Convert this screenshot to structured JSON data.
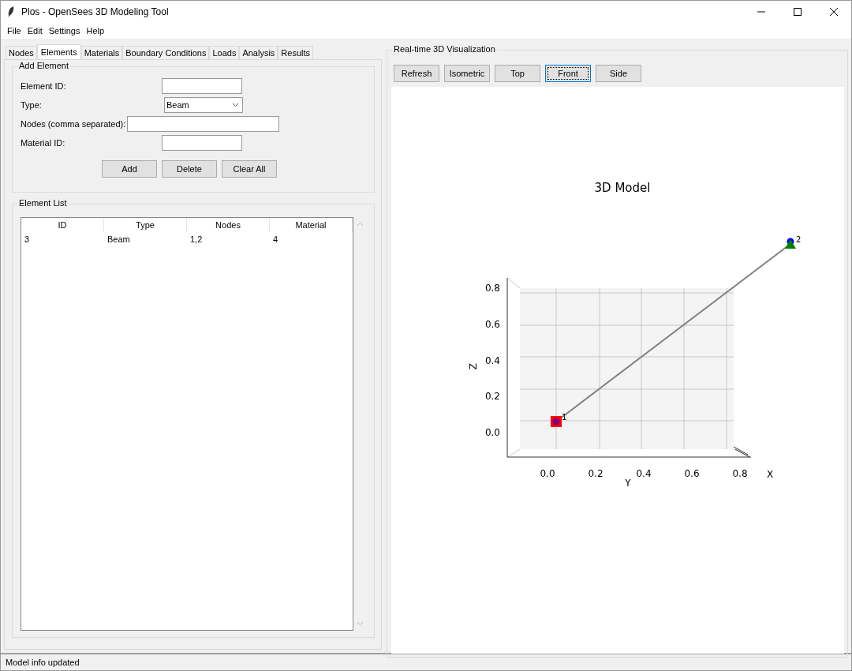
{
  "window": {
    "title": "Plos - OpenSees 3D Modeling Tool"
  },
  "menu": [
    "File",
    "Edit",
    "Settings",
    "Help"
  ],
  "tabs": [
    {
      "label": "Nodes",
      "selected": false
    },
    {
      "label": "Elements",
      "selected": true
    },
    {
      "label": "Materials",
      "selected": false
    },
    {
      "label": "Boundary Conditions",
      "selected": false
    },
    {
      "label": "Loads",
      "selected": false
    },
    {
      "label": "Analysis",
      "selected": false
    },
    {
      "label": "Results",
      "selected": false
    }
  ],
  "add_element": {
    "title": "Add Element",
    "fields": [
      {
        "label": "Element ID:",
        "kind": "text"
      },
      {
        "label": "Type:",
        "kind": "select",
        "value": "Beam"
      },
      {
        "label": "Nodes (comma separated):",
        "kind": "wide"
      },
      {
        "label": "Material ID:",
        "kind": "text"
      }
    ],
    "buttons": [
      "Add",
      "Delete",
      "Clear All"
    ]
  },
  "element_list": {
    "title": "Element List",
    "columns": [
      "ID",
      "Type",
      "Nodes",
      "Material"
    ],
    "rows": [
      [
        "3",
        "Beam",
        "1,2",
        "4"
      ]
    ]
  },
  "visualization": {
    "title": "Real-time 3D Visualization",
    "view_buttons": [
      {
        "label": "Refresh",
        "focused": false
      },
      {
        "label": "Isometric",
        "focused": false
      },
      {
        "label": "Top",
        "focused": false
      },
      {
        "label": "Front",
        "focused": true
      },
      {
        "label": "Side",
        "focused": false
      }
    ],
    "plot": {
      "title": "3D Model",
      "z_label": "Z",
      "y_label": "Y",
      "x_label": "X",
      "z_ticks": [
        "0.8",
        "0.6",
        "0.4",
        "0.2",
        "0.0"
      ],
      "y_ticks": [
        "0.0",
        "0.2",
        "0.4",
        "0.6",
        "0.8"
      ],
      "nodes": [
        {
          "label": "1",
          "kind": "square"
        },
        {
          "label": "2",
          "kind": "triangle"
        }
      ]
    }
  },
  "status_bar": "Model info updated"
}
